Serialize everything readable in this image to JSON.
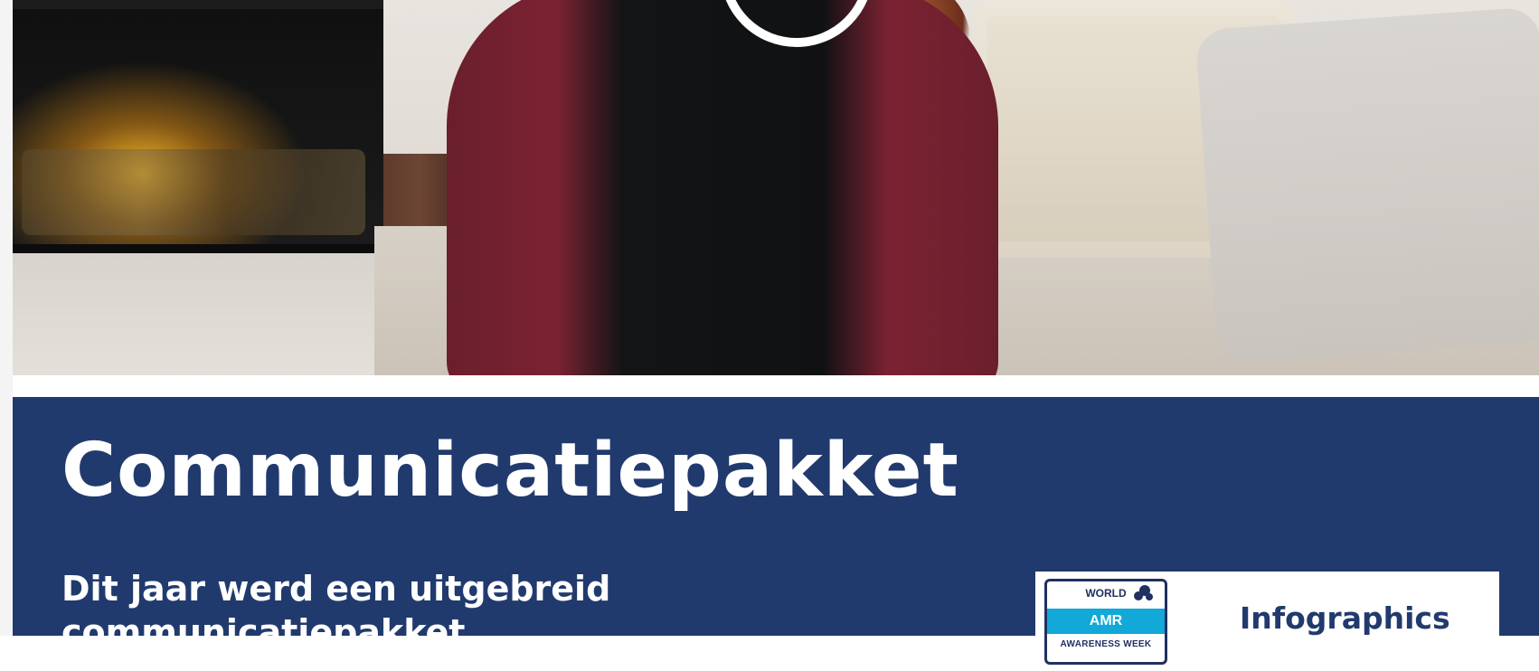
{
  "hero": {
    "play_icon": "play-icon"
  },
  "communicatie": {
    "title": "Communicatiepakket",
    "intro": "Dit jaar werd een uitgebreid communicatiepakket"
  },
  "infographic_card": {
    "badge": {
      "top": "WORLD",
      "band": "AMR",
      "bottom": "AWARENESS WEEK"
    },
    "title": "Infographics"
  },
  "colors": {
    "section_bg": "#213a6e",
    "badge_band": "#12a8d8",
    "badge_text": "#203061"
  }
}
